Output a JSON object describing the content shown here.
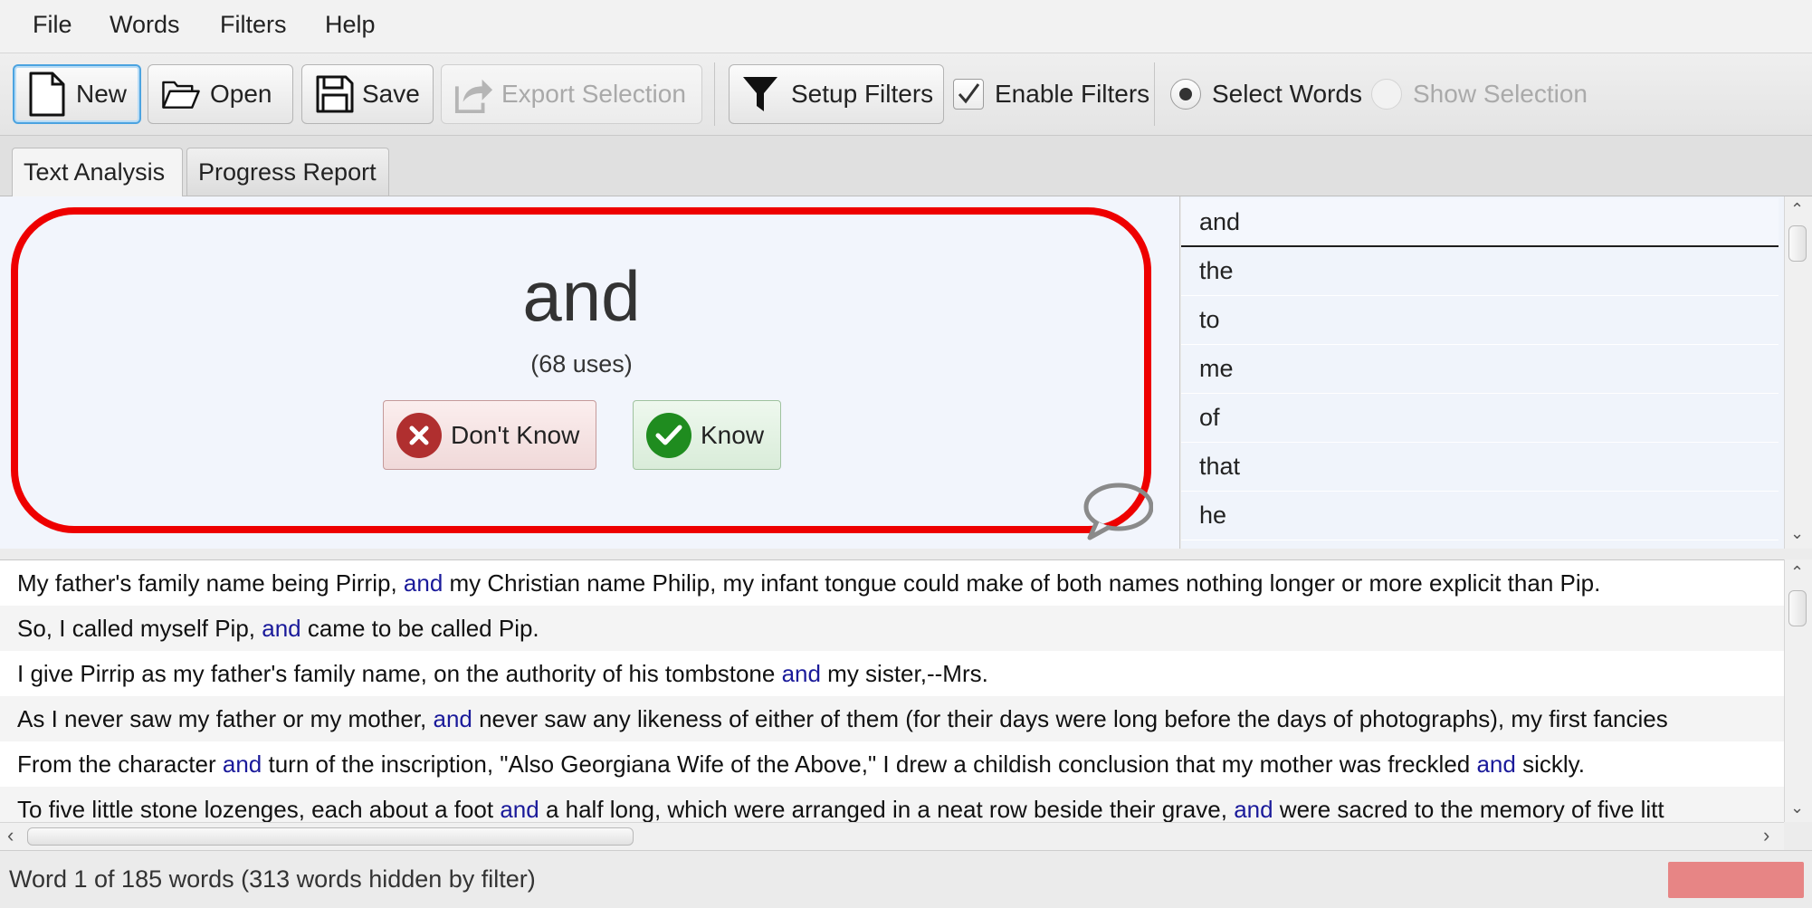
{
  "menubar": {
    "items": [
      "File",
      "Words",
      "Filters",
      "Help"
    ]
  },
  "toolbar": {
    "new_label": "New",
    "open_label": "Open",
    "save_label": "Save",
    "export_label": "Export Selection",
    "setup_filters_label": "Setup Filters",
    "enable_filters_label": "Enable Filters",
    "enable_filters_checked": true,
    "select_words_label": "Select Words",
    "show_selection_label": "Show Selection",
    "mode_selected": "Select Words"
  },
  "tabs": [
    {
      "label": "Text Analysis",
      "active": true
    },
    {
      "label": "Progress Report",
      "active": false
    }
  ],
  "word_card": {
    "word": "and",
    "uses": "(68 uses)",
    "dont_know_label": "Don't Know",
    "know_label": "Know"
  },
  "word_list": [
    "and",
    "the",
    "to",
    "me",
    "of",
    "that",
    "he"
  ],
  "sentences": [
    [
      "My father's family name being Pirrip, ",
      "and",
      " my Christian name Philip, my infant tongue could make of both names nothing longer or more explicit than Pip."
    ],
    [
      "So, I called myself Pip, ",
      "and",
      " came to be called Pip."
    ],
    [
      "I give Pirrip as my father's family name, on the authority of his tombstone ",
      "and",
      " my sister,--Mrs."
    ],
    [
      "As I never saw my father or my mother, ",
      "and",
      " never saw any likeness of either of them (for their days were long before the days of photographs), my first fancies"
    ],
    [
      "From the character ",
      "and",
      " turn of the inscription, \"Also Georgiana Wife of the Above,\" I drew a childish conclusion that my mother was freckled ",
      "and",
      " sickly."
    ],
    [
      "To five little stone lozenges, each about a foot ",
      "and",
      " a half long, which were arranged in a neat row beside their grave, ",
      "and",
      " were sacred to the memory of five litt"
    ]
  ],
  "status": {
    "text": "Word 1 of 185 words (313 words hidden by filter)"
  },
  "colors": {
    "highlight_frame": "#ee0000",
    "keyword": "#1a1a9a",
    "status_indicator": "#e78585"
  }
}
